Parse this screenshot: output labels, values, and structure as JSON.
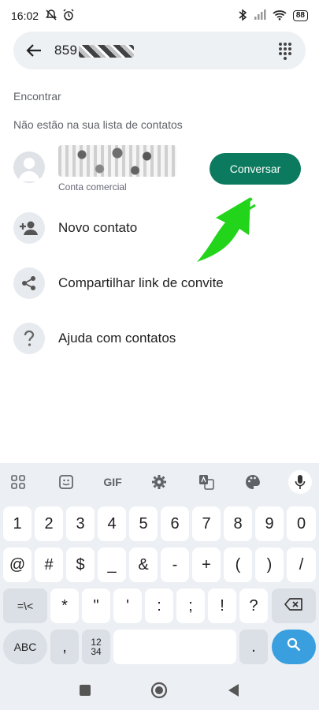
{
  "status": {
    "time": "16:02",
    "battery": "88"
  },
  "search": {
    "query_visible": "859"
  },
  "sections": {
    "find": "Encontrar",
    "not_in_contacts": "Não estão na sua lista de contatos"
  },
  "result": {
    "subtitle": "Conta comercial",
    "action_label": "Conversar"
  },
  "actions": [
    {
      "label": "Novo contato",
      "icon": "add-person-icon"
    },
    {
      "label": "Compartilhar link de convite",
      "icon": "share-icon"
    },
    {
      "label": "Ajuda com contatos",
      "icon": "help-icon"
    }
  ],
  "keyboard": {
    "toolbar": [
      "apps-icon",
      "sticker-icon",
      "GIF",
      "gear-icon",
      "translate-icon",
      "palette-icon",
      "mic-icon"
    ],
    "row1": [
      "1",
      "2",
      "3",
      "4",
      "5",
      "6",
      "7",
      "8",
      "9",
      "0"
    ],
    "row2": [
      "@",
      "#",
      "$",
      "_",
      "&",
      "-",
      "+",
      "(",
      ")",
      "/"
    ],
    "row3": [
      "=\\<",
      "*",
      "\"",
      "'",
      ":",
      ";",
      "!",
      "?"
    ],
    "row4": {
      "abc": "ABC",
      "comma": ",",
      "numpad_top": "12",
      "numpad_bottom": "34",
      "period": "."
    }
  },
  "colors": {
    "accent": "#0b7a5e",
    "arrow": "#22d41a",
    "search_key": "#3a9fdf"
  }
}
